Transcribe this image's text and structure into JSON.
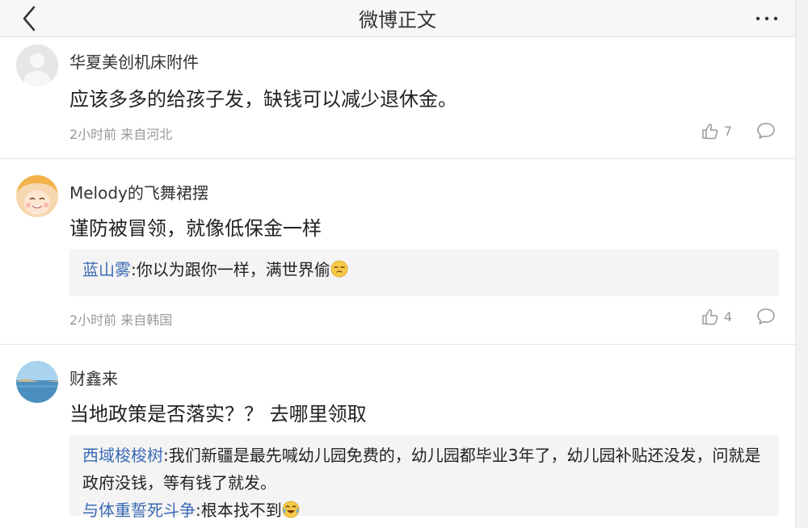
{
  "header": {
    "title": "微博正文",
    "more": "···"
  },
  "comments": [
    {
      "user": "华夏美创机床附件",
      "text": "应该多多的给孩子发，缺钱可以减少退休金。",
      "meta": "2小时前 来自河北",
      "likes": "7",
      "replies": []
    },
    {
      "user": "Melody的飞舞裙摆",
      "text": "谨防被冒领，就像低保金一样",
      "meta": "2小时前 来自韩国",
      "likes": "4",
      "replies": [
        {
          "user": "蓝山雾",
          "text": ":你以为跟你一样，满世界偷",
          "emoji": "sleepy-face-emoji"
        }
      ]
    },
    {
      "user": "财鑫来",
      "text": "当地政策是否落实？？ 去哪里领取",
      "meta": "",
      "likes": "",
      "replies": [
        {
          "user": "西域梭梭树",
          "text": ":我们新疆是最先喊幼儿园免费的，幼儿园都毕业3年了，幼儿园补贴还没发，问就是政府没钱，等有钱了就发。"
        },
        {
          "user": "与体重誓死斗争",
          "text": ":根本找不到",
          "emoji": "laughing-tears-emoji"
        }
      ]
    }
  ],
  "colors": {
    "link": "#3b6bb5",
    "meta": "#999999",
    "reply_bg": "#f4f4f4"
  }
}
